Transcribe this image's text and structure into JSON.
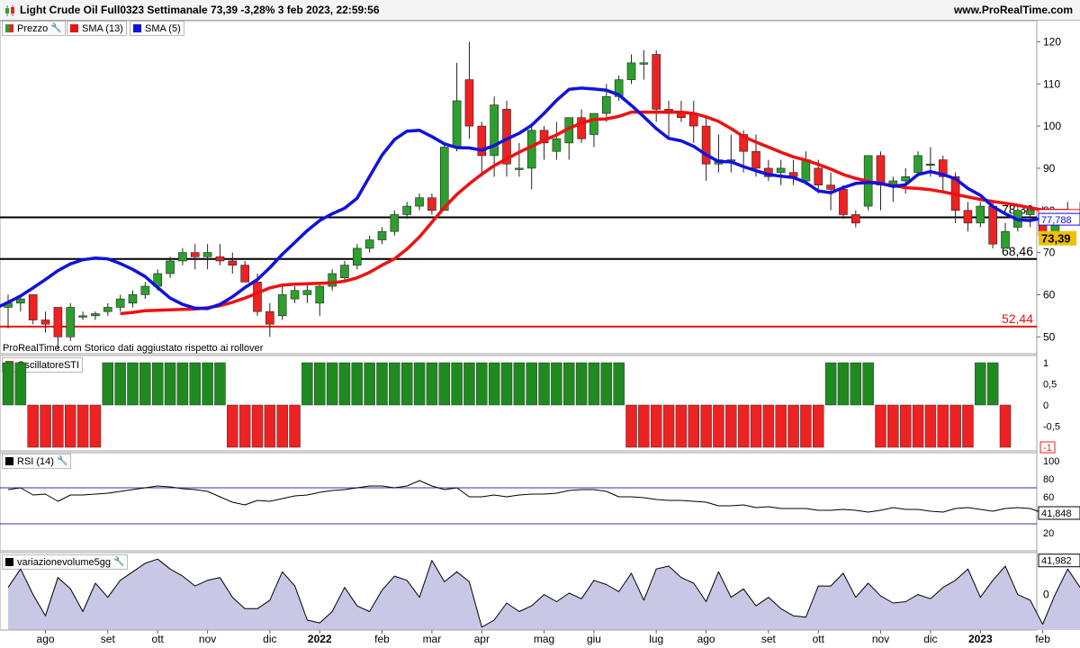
{
  "header": {
    "title": "Light Crude Oil Full0323 Settimanale 73,39 -3,28% 3 feb 2023, 22:59:56",
    "site": "www.ProRealTime.com"
  },
  "legends": {
    "price": "Prezzo",
    "sma13": "SMA (13)",
    "sma5": "SMA (5)",
    "osc": "OscillatoreSTI",
    "rsi": "RSI (14)",
    "vol": "variazionevolume5gg"
  },
  "watermark": {
    "source": "ProRealTime.com",
    "note": "Storico dati aggiustato rispetto ai rollover"
  },
  "colors": {
    "up": "#2ca02c",
    "down": "#ee2222",
    "sma13": "#ee1111",
    "sma5": "#1111dd",
    "osc_up": "#1f8a1f",
    "osc_down": "#ee2222",
    "vol_fill": "#c8c8e6",
    "current_price": "#f0c000"
  },
  "chart_data": [
    {
      "type": "candlestick",
      "name": "price",
      "ylim": [
        46,
        125
      ],
      "yticks": [
        50,
        60,
        70,
        80,
        90,
        100,
        110,
        120
      ],
      "candles": [
        {
          "o": 57,
          "h": 60,
          "l": 52,
          "c": 58
        },
        {
          "o": 58,
          "h": 60,
          "l": 56,
          "c": 59
        },
        {
          "o": 60,
          "h": 60,
          "l": 53,
          "c": 54
        },
        {
          "o": 54,
          "h": 56,
          "l": 51,
          "c": 53
        },
        {
          "o": 57,
          "h": 57,
          "l": 47,
          "c": 50
        },
        {
          "o": 50,
          "h": 58,
          "l": 49,
          "c": 57
        },
        {
          "o": 55,
          "h": 56,
          "l": 54,
          "c": 55
        },
        {
          "o": 55,
          "h": 56,
          "l": 54,
          "c": 55.5
        },
        {
          "o": 56,
          "h": 58,
          "l": 55,
          "c": 57
        },
        {
          "o": 57,
          "h": 60,
          "l": 56,
          "c": 59
        },
        {
          "o": 58,
          "h": 61,
          "l": 57,
          "c": 60
        },
        {
          "o": 60,
          "h": 63,
          "l": 59,
          "c": 62
        },
        {
          "o": 62,
          "h": 66,
          "l": 61,
          "c": 65
        },
        {
          "o": 65,
          "h": 69,
          "l": 64,
          "c": 68
        },
        {
          "o": 68,
          "h": 71,
          "l": 67,
          "c": 70
        },
        {
          "o": 70,
          "h": 72,
          "l": 66,
          "c": 69
        },
        {
          "o": 69,
          "h": 72,
          "l": 66,
          "c": 70
        },
        {
          "o": 69,
          "h": 72,
          "l": 67,
          "c": 68
        },
        {
          "o": 68,
          "h": 70,
          "l": 65,
          "c": 67
        },
        {
          "o": 67,
          "h": 68,
          "l": 63,
          "c": 63
        },
        {
          "o": 63,
          "h": 65,
          "l": 55,
          "c": 56
        },
        {
          "o": 56,
          "h": 58,
          "l": 50,
          "c": 53
        },
        {
          "o": 55,
          "h": 62,
          "l": 54,
          "c": 60
        },
        {
          "o": 59,
          "h": 62,
          "l": 58,
          "c": 61
        },
        {
          "o": 60,
          "h": 63,
          "l": 58,
          "c": 61
        },
        {
          "o": 58,
          "h": 63,
          "l": 55,
          "c": 62
        },
        {
          "o": 62,
          "h": 66,
          "l": 61,
          "c": 65
        },
        {
          "o": 64,
          "h": 68,
          "l": 63,
          "c": 67
        },
        {
          "o": 67,
          "h": 72,
          "l": 66,
          "c": 71
        },
        {
          "o": 71,
          "h": 74,
          "l": 70,
          "c": 73
        },
        {
          "o": 73,
          "h": 76,
          "l": 72,
          "c": 75
        },
        {
          "o": 75,
          "h": 80,
          "l": 74,
          "c": 79
        },
        {
          "o": 79,
          "h": 82,
          "l": 78,
          "c": 81
        },
        {
          "o": 81,
          "h": 84,
          "l": 80,
          "c": 83
        },
        {
          "o": 83,
          "h": 84,
          "l": 79,
          "c": 80
        },
        {
          "o": 80,
          "h": 96,
          "l": 80,
          "c": 95
        },
        {
          "o": 95,
          "h": 115,
          "l": 94,
          "c": 106
        },
        {
          "o": 111,
          "h": 120,
          "l": 97,
          "c": 100
        },
        {
          "o": 100,
          "h": 101,
          "l": 88,
          "c": 93
        },
        {
          "o": 93,
          "h": 107,
          "l": 88,
          "c": 105
        },
        {
          "o": 104,
          "h": 106,
          "l": 88,
          "c": 91
        },
        {
          "o": 90,
          "h": 96,
          "l": 88,
          "c": 90
        },
        {
          "o": 90,
          "h": 100,
          "l": 85,
          "c": 99
        },
        {
          "o": 99,
          "h": 100,
          "l": 92,
          "c": 96
        },
        {
          "o": 94,
          "h": 101,
          "l": 92,
          "c": 97
        },
        {
          "o": 96,
          "h": 102,
          "l": 92,
          "c": 102
        },
        {
          "o": 102,
          "h": 104,
          "l": 96,
          "c": 97
        },
        {
          "o": 98,
          "h": 103,
          "l": 95,
          "c": 103
        },
        {
          "o": 103,
          "h": 110,
          "l": 101,
          "c": 107
        },
        {
          "o": 107,
          "h": 112,
          "l": 106,
          "c": 111
        },
        {
          "o": 111,
          "h": 117,
          "l": 110,
          "c": 115
        },
        {
          "o": 115,
          "h": 118,
          "l": 111,
          "c": 115
        },
        {
          "o": 117,
          "h": 118,
          "l": 101,
          "c": 104
        },
        {
          "o": 104,
          "h": 106,
          "l": 97,
          "c": 103
        },
        {
          "o": 103,
          "h": 106,
          "l": 101,
          "c": 102
        },
        {
          "o": 103,
          "h": 106,
          "l": 96,
          "c": 100
        },
        {
          "o": 100,
          "h": 102,
          "l": 87,
          "c": 91
        },
        {
          "o": 91,
          "h": 98,
          "l": 89,
          "c": 92
        },
        {
          "o": 92,
          "h": 98,
          "l": 89,
          "c": 92
        },
        {
          "o": 98,
          "h": 99,
          "l": 89,
          "c": 94
        },
        {
          "o": 94,
          "h": 98,
          "l": 88,
          "c": 90
        },
        {
          "o": 90,
          "h": 92,
          "l": 87,
          "c": 88
        },
        {
          "o": 89,
          "h": 92,
          "l": 86,
          "c": 90
        },
        {
          "o": 89,
          "h": 92,
          "l": 86,
          "c": 88
        },
        {
          "o": 87,
          "h": 94,
          "l": 86,
          "c": 92
        },
        {
          "o": 90,
          "h": 92,
          "l": 84,
          "c": 86
        },
        {
          "o": 86,
          "h": 89,
          "l": 80,
          "c": 85
        },
        {
          "o": 85,
          "h": 86,
          "l": 78,
          "c": 79
        },
        {
          "o": 79,
          "h": 80,
          "l": 76,
          "c": 77
        },
        {
          "o": 81,
          "h": 93,
          "l": 80,
          "c": 93
        },
        {
          "o": 93,
          "h": 94,
          "l": 80,
          "c": 86
        },
        {
          "o": 86,
          "h": 88,
          "l": 82,
          "c": 87
        },
        {
          "o": 87,
          "h": 90,
          "l": 84,
          "c": 88
        },
        {
          "o": 89,
          "h": 94,
          "l": 88,
          "c": 93
        },
        {
          "o": 91,
          "h": 95,
          "l": 88,
          "c": 91
        },
        {
          "o": 92,
          "h": 93,
          "l": 84,
          "c": 88
        },
        {
          "o": 88,
          "h": 89,
          "l": 77,
          "c": 80
        },
        {
          "o": 80,
          "h": 82,
          "l": 75,
          "c": 77
        },
        {
          "o": 77,
          "h": 82,
          "l": 76,
          "c": 81
        },
        {
          "o": 81,
          "h": 82,
          "l": 71,
          "c": 72
        },
        {
          "o": 71,
          "h": 77,
          "l": 71,
          "c": 75
        },
        {
          "o": 76,
          "h": 81,
          "l": 75,
          "c": 80
        },
        {
          "o": 79,
          "h": 81,
          "l": 76,
          "c": 80
        },
        {
          "o": 80,
          "h": 81,
          "l": 73,
          "c": 74
        },
        {
          "o": 74,
          "h": 80,
          "l": 73,
          "c": 80
        },
        {
          "o": 80,
          "h": 82,
          "l": 77,
          "c": 78
        },
        {
          "o": 79,
          "h": 82,
          "l": 77,
          "c": 80
        },
        {
          "o": 79,
          "h": 80,
          "l": 73,
          "c": 73.39
        }
      ],
      "sma13": [
        55.5,
        55.8,
        56.2,
        56.3,
        56.4,
        56.5,
        56.6,
        56.9,
        57.4,
        58.2,
        59.2,
        60.4,
        61.6,
        62.3,
        62.5,
        62.6,
        62.7,
        62.8,
        63.2,
        64,
        65.3,
        67,
        68.5,
        70.8,
        73.7,
        77.2,
        80.7,
        83.8,
        86.3,
        88.6,
        90.6,
        92.2,
        93.8,
        95.2,
        96.6,
        97.9,
        99.5,
        100.7,
        101.6,
        101.7,
        102.3,
        103.3,
        103.3,
        103.3,
        103.3,
        103.3,
        103,
        102.2,
        101.1,
        99.4,
        97.5,
        96.2,
        95,
        93.8,
        92.7,
        91.9,
        90.9,
        89.8,
        88.5,
        87.6,
        86.9,
        86.3,
        85.9,
        85.4,
        85.2,
        84.9,
        84.4,
        83.8,
        83.2,
        82.6,
        82.1,
        81.7,
        81.2,
        80.6,
        80.1,
        80,
        80,
        79.5,
        78.7
      ],
      "sma5": [
        59,
        59.2,
        58.8,
        57.5,
        56,
        55,
        54.2,
        53.3,
        52.6,
        52.9,
        54,
        55.4,
        56.8,
        58.2,
        59.7,
        61.6,
        63.6,
        65.7,
        67.3,
        68.3,
        68.7,
        68.5,
        67.4,
        66,
        64.3,
        61.7,
        59.2,
        57.7,
        56.8,
        56.7,
        57.7,
        59.5,
        61.7,
        63.6,
        66.4,
        69.6,
        72.4,
        75.2,
        77.6,
        79.2,
        80.5,
        82.9,
        88,
        93.1,
        96.8,
        98.8,
        99,
        97.5,
        95.8,
        94.9,
        94.8,
        94.3,
        95.4,
        96.9,
        98.3,
        100.2,
        103,
        106.1,
        108.7,
        109,
        108.8,
        108.5,
        107.4,
        104.9,
        102.2,
        99.4,
        97.1,
        96.5,
        95.2,
        93.2,
        91.6,
        91.5,
        90.4,
        89.4,
        88.5,
        88.1,
        87.8,
        86.6,
        84.6,
        84.2,
        85.4,
        86.4,
        86.6,
        86.4,
        85.7,
        86.1,
        88.5,
        89.2,
        88.5,
        87.5,
        85.2,
        83.6,
        80.9,
        79.2,
        77.8,
        77.6,
        78.2,
        78.7,
        78.9,
        78.3,
        77.4
      ],
      "levels": [
        {
          "value": 78.36,
          "label": "78,36",
          "color": "#000000"
        },
        {
          "value": 68.46,
          "label": "68,46",
          "color": "#000000"
        },
        {
          "value": 52.44,
          "label": "52,44",
          "color": "#ee1111"
        }
      ],
      "axis_tags": [
        {
          "value": 78.708,
          "label": "78,708",
          "color": "#ee1111"
        },
        {
          "value": 77.788,
          "label": "77,788",
          "color": "#1111dd"
        },
        {
          "value": 73.39,
          "label": "73,39",
          "color": "#f0c000"
        }
      ]
    },
    {
      "type": "bar",
      "name": "OscillatoreSTI",
      "ylim": [
        -1,
        1
      ],
      "ytick_labels": [
        "1",
        "0,5",
        "0",
        "-0,5",
        "-1"
      ],
      "values": [
        1,
        1,
        -1,
        -1,
        -1,
        -1,
        -1,
        -1,
        1,
        1,
        1,
        1,
        1,
        1,
        1,
        1,
        1,
        1,
        -1,
        -1,
        -1,
        -1,
        -1,
        -1,
        1,
        1,
        1,
        1,
        1,
        1,
        1,
        1,
        1,
        1,
        1,
        1,
        1,
        1,
        1,
        1,
        1,
        1,
        1,
        1,
        1,
        1,
        1,
        1,
        1,
        1,
        -1,
        -1,
        -1,
        -1,
        -1,
        -1,
        -1,
        -1,
        -1,
        -1,
        -1,
        -1,
        -1,
        -1,
        -1,
        -1,
        1,
        1,
        1,
        1,
        -1,
        -1,
        -1,
        -1,
        -1,
        -1,
        -1,
        -1,
        1,
        1,
        -1
      ]
    },
    {
      "type": "line",
      "name": "RSI (14)",
      "ylim": [
        0,
        100
      ],
      "yticks": [
        20,
        40,
        60,
        80,
        100
      ],
      "bands": [
        30,
        70
      ],
      "current_label": "41,848",
      "values": [
        68,
        70,
        62,
        63,
        55,
        62,
        62,
        63,
        64,
        66,
        68,
        70,
        72,
        71,
        69,
        68,
        66,
        60,
        54,
        51,
        56,
        55,
        58,
        61,
        62,
        65,
        67,
        68,
        70,
        72,
        72,
        70,
        72,
        78,
        72,
        68,
        70,
        60,
        60,
        62,
        60,
        62,
        63,
        63,
        64,
        67,
        68,
        68,
        66,
        60,
        60,
        59,
        57,
        56,
        56,
        55,
        54,
        50,
        50,
        51,
        48,
        49,
        47,
        47,
        47,
        45,
        45,
        46,
        45,
        43,
        45,
        48,
        46,
        46,
        44,
        43,
        47,
        48,
        46,
        44,
        47,
        48,
        47,
        42
      ]
    },
    {
      "type": "area",
      "name": "variazionevolume5gg",
      "ylim": [
        -2.5,
        2.7
      ],
      "yticks": [
        0
      ],
      "current_label": "41,982",
      "values": [
        0.5,
        1.8,
        0.0,
        -1.5,
        1.2,
        0.4,
        -1.2,
        0.8,
        -0.2,
        1.0,
        1.6,
        2.2,
        2.5,
        1.8,
        1.3,
        0.6,
        1.0,
        1.2,
        -0.2,
        -1.0,
        -1.0,
        -0.4,
        1.6,
        0.6,
        -1.8,
        -2.0,
        -1.2,
        0.5,
        -0.8,
        -1.2,
        0.3,
        1.3,
        1.0,
        -0.2,
        2.4,
        0.9,
        1.6,
        0.9,
        -2.3,
        -1.8,
        -0.6,
        -1.2,
        -0.8,
        0.0,
        -0.5,
        0.1,
        -0.3,
        1.0,
        0.7,
        0.2,
        1.5,
        -0.4,
        1.8,
        2.0,
        1.2,
        0.8,
        -0.5,
        1.6,
        -0.2,
        0.4,
        -0.8,
        -0.2,
        -1.0,
        -1.5,
        -1.6,
        0.6,
        0.6,
        1.5,
        -0.2,
        0.8,
        -0.1,
        -0.6,
        -0.5,
        0.0,
        -0.3,
        0.5,
        1.0,
        1.8,
        -0.2,
        1.0,
        2.0,
        0.0,
        -0.4,
        -2.1,
        0.0,
        1.8,
        0.5,
        2.3
      ]
    }
  ],
  "x_axis": {
    "labels": [
      {
        "text": "ago",
        "i": 3
      },
      {
        "text": "set",
        "i": 8
      },
      {
        "text": "ott",
        "i": 12
      },
      {
        "text": "nov",
        "i": 16
      },
      {
        "text": "dic",
        "i": 21
      },
      {
        "text": "2022",
        "i": 25,
        "bold": true
      },
      {
        "text": "feb",
        "i": 30
      },
      {
        "text": "mar",
        "i": 34
      },
      {
        "text": "apr",
        "i": 38
      },
      {
        "text": "mag",
        "i": 43
      },
      {
        "text": "giu",
        "i": 47
      },
      {
        "text": "lug",
        "i": 52
      },
      {
        "text": "ago",
        "i": 56
      },
      {
        "text": "set",
        "i": 61
      },
      {
        "text": "ott",
        "i": 65
      },
      {
        "text": "nov",
        "i": 70
      },
      {
        "text": "dic",
        "i": 74
      },
      {
        "text": "2023",
        "i": 78,
        "bold": true
      },
      {
        "text": "feb",
        "i": 83
      }
    ]
  }
}
